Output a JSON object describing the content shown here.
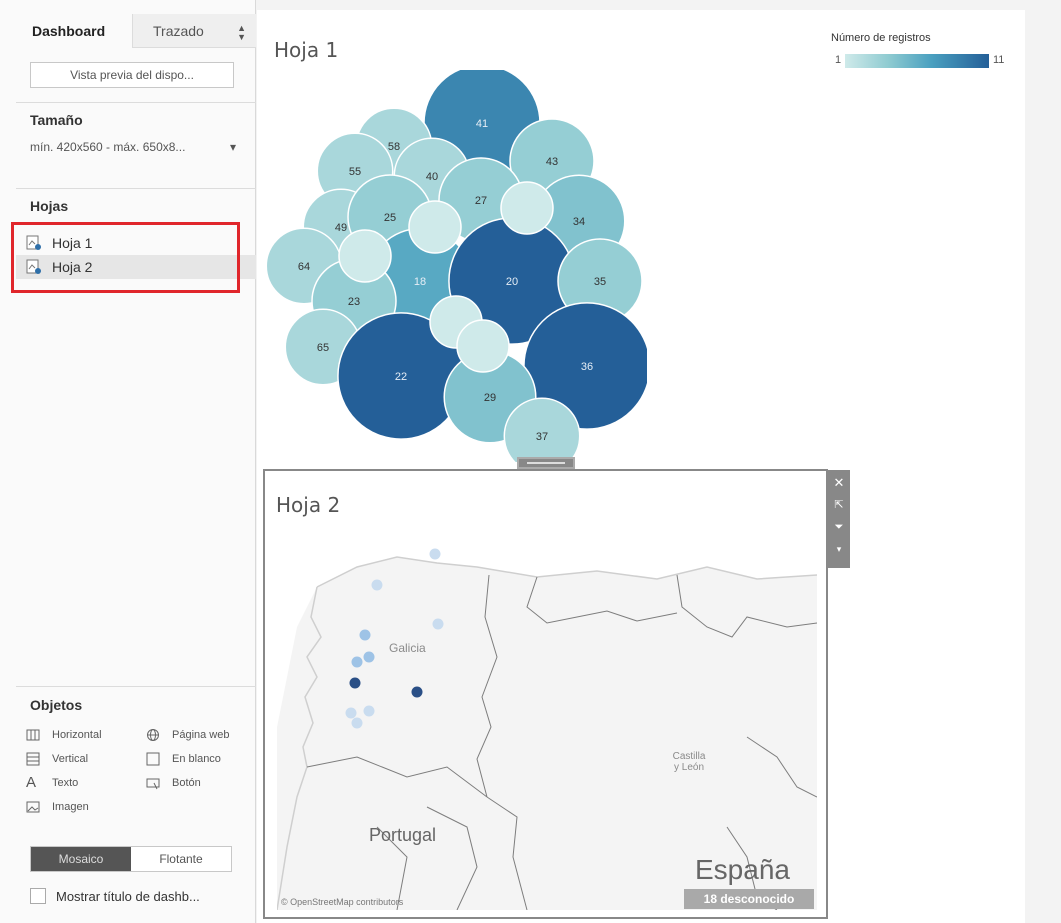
{
  "sidebar": {
    "tabs": [
      {
        "label": "Dashboard",
        "active": true
      },
      {
        "label": "Trazado",
        "active": false
      }
    ],
    "preview_button": "Vista previa del dispo...",
    "size": {
      "title": "Tamaño",
      "value": "mín. 420x560 - máx. 650x8..."
    },
    "sheets": {
      "title": "Hojas",
      "items": [
        {
          "label": "Hoja 1",
          "selected": false
        },
        {
          "label": "Hoja 2",
          "selected": true
        }
      ]
    },
    "objects": {
      "title": "Objetos",
      "items": [
        {
          "label": "Horizontal",
          "icon": "horizontal-container-icon"
        },
        {
          "label": "Página web",
          "icon": "globe-icon"
        },
        {
          "label": "Vertical",
          "icon": "vertical-container-icon"
        },
        {
          "label": "En blanco",
          "icon": "blank-icon"
        },
        {
          "label": "Texto",
          "icon": "text-icon"
        },
        {
          "label": "Botón",
          "icon": "button-icon"
        },
        {
          "label": "Imagen",
          "icon": "image-icon"
        }
      ]
    },
    "layout_mode": {
      "tiled": "Mosaico",
      "floating": "Flotante",
      "selected": "Mosaico"
    },
    "show_title": {
      "label": "Mostrar título de dashb...",
      "checked": false
    }
  },
  "dashboard": {
    "sheet1": {
      "title": "Hoja 1"
    },
    "sheet2": {
      "title": "Hoja 2"
    },
    "legend": {
      "title": "Número de registros",
      "min": "1",
      "max": "11",
      "colors": [
        "#cfeaea",
        "#8fcbd1",
        "#4aa0c0",
        "#245f98"
      ]
    },
    "map": {
      "labels": {
        "galicia": "Galicia",
        "castilla": "Castilla\ny León",
        "portugal": "Portugal",
        "espana": "España"
      },
      "unknown_badge": "18 desconocido",
      "attribution": "© OpenStreetMap contributors"
    }
  },
  "chart_data": {
    "type": "bubble",
    "title": "Hoja 1",
    "legend_title": "Número de registros",
    "color_range": [
      1,
      11
    ],
    "bubbles": [
      {
        "label": "41",
        "value": 9
      },
      {
        "label": "58",
        "value": 3
      },
      {
        "label": "55",
        "value": 3
      },
      {
        "label": "40",
        "value": 3
      },
      {
        "label": "43",
        "value": 4
      },
      {
        "label": "27",
        "value": 4
      },
      {
        "label": "49",
        "value": 3
      },
      {
        "label": "25",
        "value": 4
      },
      {
        "label": "34",
        "value": 5
      },
      {
        "label": "64",
        "value": 3
      },
      {
        "label": "18",
        "value": 7
      },
      {
        "label": "20",
        "value": 11
      },
      {
        "label": "35",
        "value": 4
      },
      {
        "label": "23",
        "value": 4
      },
      {
        "label": "65",
        "value": 3
      },
      {
        "label": "22",
        "value": 11
      },
      {
        "label": "36",
        "value": 11
      },
      {
        "label": "29",
        "value": 5
      },
      {
        "label": "37",
        "value": 3
      },
      {
        "label": "",
        "value": 1
      },
      {
        "label": "",
        "value": 1
      },
      {
        "label": "",
        "value": 1
      },
      {
        "label": "",
        "value": 1
      },
      {
        "label": "",
        "value": 1
      }
    ],
    "map_points": [
      {
        "value": 1
      },
      {
        "value": 1
      },
      {
        "value": 2
      },
      {
        "value": 1
      },
      {
        "value": 2
      },
      {
        "value": 2
      },
      {
        "value": 9
      },
      {
        "value": 11
      },
      {
        "value": 1
      },
      {
        "value": 1
      },
      {
        "value": 1
      }
    ]
  }
}
